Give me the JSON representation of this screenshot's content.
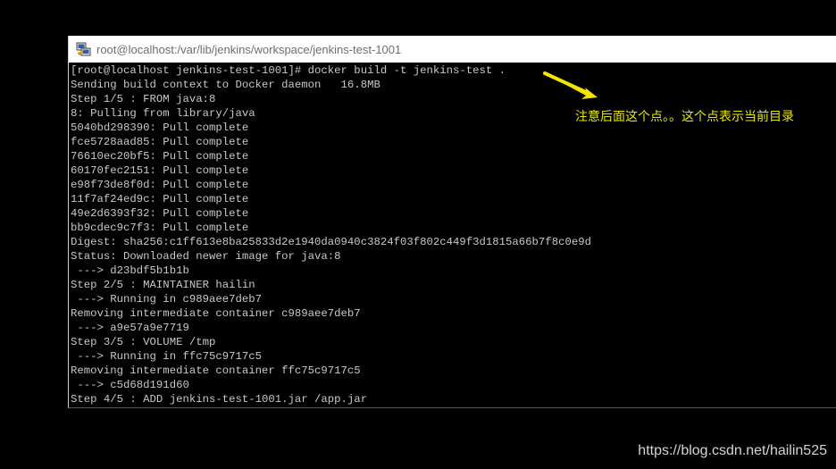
{
  "window": {
    "title": "root@localhost:/var/lib/jenkins/workspace/jenkins-test-1001"
  },
  "terminal": {
    "lines": [
      "[root@localhost jenkins-test-1001]# docker build -t jenkins-test .",
      "Sending build context to Docker daemon   16.8MB",
      "Step 1/5 : FROM java:8",
      "8: Pulling from library/java",
      "5040bd298390: Pull complete",
      "fce5728aad85: Pull complete",
      "76610ec20bf5: Pull complete",
      "60170fec2151: Pull complete",
      "e98f73de8f0d: Pull complete",
      "11f7af24ed9c: Pull complete",
      "49e2d6393f32: Pull complete",
      "bb9cdec9c7f3: Pull complete",
      "Digest: sha256:c1ff613e8ba25833d2e1940da0940c3824f03f802c449f3d1815a66b7f8c0e9d",
      "Status: Downloaded newer image for java:8",
      " ---> d23bdf5b1b1b",
      "Step 2/5 : MAINTAINER hailin",
      " ---> Running in c989aee7deb7",
      "Removing intermediate container c989aee7deb7",
      " ---> a9e57a9e7719",
      "Step 3/5 : VOLUME /tmp",
      " ---> Running in ffc75c9717c5",
      "Removing intermediate container ffc75c9717c5",
      " ---> c5d68d191d60",
      "Step 4/5 : ADD jenkins-test-1001.jar /app.jar"
    ]
  },
  "annotation": {
    "text": "注意后面这个点。。这个点表示当前目录",
    "color": "#e8e800"
  },
  "watermark": {
    "text": "https://blog.csdn.net/hailin525"
  },
  "icons": {
    "app": "putty-icon",
    "arrow": "annotation-arrow-icon"
  }
}
